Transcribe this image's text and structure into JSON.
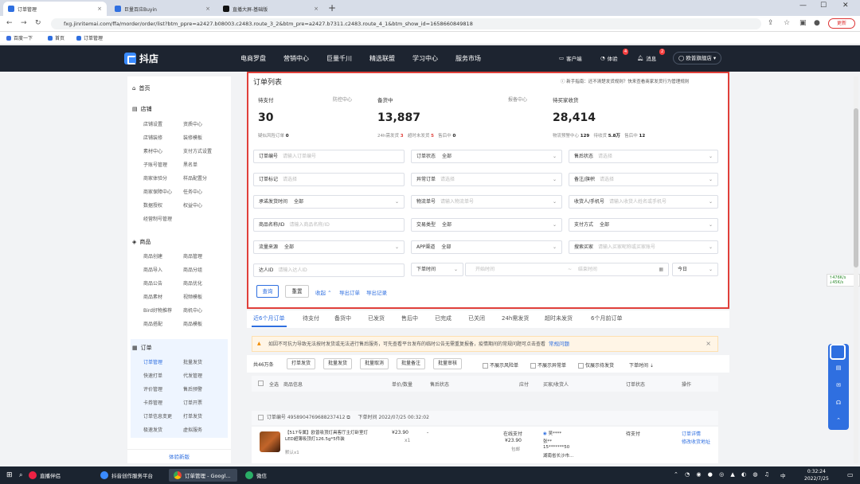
{
  "browser": {
    "tabs": [
      {
        "label": "订单管理",
        "active": true
      },
      {
        "label": "巨量百应Buyin",
        "active": false
      },
      {
        "label": "直播大屏-基础版",
        "active": false
      }
    ],
    "url": "fxg.jinritemai.com/ffa/morder/order/list?btm_ppre=a2427.b08003.c2483.route_3_2&btm_pre=a2427.b7311.c2483.route_4_1&btm_show_id=1658660849818",
    "update_label": "更新",
    "bookmarks": [
      "百度一下",
      "首页",
      "订单管理"
    ]
  },
  "app": {
    "logo_text": "抖店",
    "nav": [
      "电商罗盘",
      "营销中心",
      "巨量千川",
      "精选联盟",
      "学习中心",
      "服务市场"
    ],
    "header_right": {
      "service": "客户端",
      "experience": "体验",
      "experience_badge": "4",
      "messages": "消息",
      "messages_badge": "2",
      "user": "欧普旗舰店"
    }
  },
  "sidebar": {
    "home": "首页",
    "store_section": "店铺",
    "store_items": [
      [
        "店铺设置",
        "资质中心"
      ],
      [
        "店铺装修",
        "装修模板"
      ],
      [
        "素材中心",
        "支付方式设置"
      ],
      [
        "子账号管理",
        "黑名单"
      ],
      [
        "商家体验分",
        "样品配置分"
      ],
      [
        "商家保障中心",
        "任务中心"
      ],
      [
        "数据授权",
        "权益中心"
      ],
      [
        "经营制号管理",
        ""
      ]
    ],
    "goods_section": "商品",
    "goods_items": [
      [
        "商品创建",
        "商品管理"
      ],
      [
        "商品导入",
        "商品分组"
      ],
      [
        "商品公告",
        "商品优化"
      ],
      [
        "商品素材",
        "视频模板"
      ],
      [
        "Bird好物推荐",
        "商机中心"
      ],
      [
        "商品搭配",
        "商品模板"
      ]
    ],
    "order_section": "订单",
    "order_items": [
      [
        "订单管理",
        "批量发货"
      ],
      [
        "快速打单",
        "代发管理"
      ],
      [
        "评价管理",
        "售后预警"
      ],
      [
        "卡券管理",
        "订单开票"
      ],
      [
        "订单信息变更",
        "打单发货"
      ],
      [
        "极速发货",
        "虚拟服务"
      ]
    ],
    "footer": "体验新版"
  },
  "order_panel": {
    "title": "订单列表",
    "tip": "新手指南：还不清楚发货规则？快来查看商家发货行为管理规则",
    "stats": [
      {
        "label": "待支付",
        "extra": "防控中心",
        "value": "30",
        "sub": "疑似风险订单",
        "sub_value": "0"
      },
      {
        "label": "备货中",
        "extra": "报备中心",
        "value": "13,887",
        "sub": "24h需发货",
        "sub_value": "3",
        "sub2": "超时未发货",
        "sub2_value": "5",
        "sub3": "售后中",
        "sub3_value": "0"
      },
      {
        "label": "待买家收货",
        "extra": "",
        "value": "28,414",
        "sub": "物流预警中心",
        "sub_value": "129",
        "sub2": "待收货",
        "sub2_value": "5.8万",
        "sub3": "售后中",
        "sub3_value": "12"
      }
    ],
    "filters": [
      {
        "label": "订单编号",
        "value": "",
        "placeholder": "请输入订单编号"
      },
      {
        "label": "订单状态",
        "value": "全部",
        "placeholder": ""
      },
      {
        "label": "售后状态",
        "value": "",
        "placeholder": "请选择"
      },
      {
        "label": "订单标记",
        "value": "",
        "placeholder": "请选择"
      },
      {
        "label": "异常订单",
        "value": "",
        "placeholder": "请选择"
      },
      {
        "label": "备注/旗帜",
        "value": "",
        "placeholder": "请选择"
      },
      {
        "label": "承诺发货时间",
        "value": "全部",
        "placeholder": ""
      },
      {
        "label": "物流单号",
        "value": "",
        "placeholder": "请输入物流单号"
      },
      {
        "label": "收货人/手机号",
        "value": "",
        "placeholder": "请输入收货人姓名或手机号"
      },
      {
        "label": "商品名称/ID",
        "value": "",
        "placeholder": "请输入商品名称/ID"
      },
      {
        "label": "交易类型",
        "value": "全部",
        "placeholder": ""
      },
      {
        "label": "支付方式",
        "value": "全部",
        "placeholder": ""
      },
      {
        "label": "流量来源",
        "value": "全部",
        "placeholder": ""
      },
      {
        "label": "APP渠道",
        "value": "全部",
        "placeholder": ""
      },
      {
        "label": "搜索买家",
        "value": "",
        "placeholder": "请输入买家昵称或买家账号"
      },
      {
        "label": "达人ID",
        "value": "",
        "placeholder": "请输入达人ID"
      }
    ],
    "time_select": "下单时间",
    "time_start": "开始时间",
    "time_sep": "~",
    "time_end": "结束时间",
    "time_today": "今日",
    "buttons": {
      "query": "查询",
      "reset": "重置",
      "collapse": "收起",
      "export": "导出订单",
      "export_log": "导出记录"
    }
  },
  "order_tabs": [
    "近6个月订单",
    "待支付",
    "备货中",
    "已发货",
    "售后中",
    "已完成",
    "已关闭",
    "24h需发货",
    "超时未发货",
    "6个月前订单"
  ],
  "notice": {
    "text": "如因不可抗力导致无法按时发货或无法进行售后服务，可先查看平台发布的临时公告无需重复报备，疫情期间的常规问题可点击查看",
    "link": "常规问题"
  },
  "toolbar": {
    "count": "共46万条",
    "actions": [
      "打单发货",
      "批量发货",
      "批量取消",
      "批量备注",
      "批量审核"
    ],
    "checks": [
      "不展示风险单",
      "不展示异常单",
      "仅展示待发货"
    ],
    "sort": "下单时间"
  },
  "table": {
    "headers": [
      "全选",
      "商品信息",
      "单价/数量",
      "售后状态",
      "应付",
      "买家/收货人",
      "订单状态",
      "操作"
    ]
  },
  "order": {
    "id_label": "订单编号",
    "id": "4958904769688237412",
    "time_label": "下单时间",
    "time": "2022/07/25 00:32:02",
    "product": "【517专属】欧普吸顶灯具客厅主灯卧室灯LED超薄吸顶灯126.5g*5件装",
    "spec": "默认x1",
    "price": "¥23.90",
    "qty": "x1",
    "after_sale": "-",
    "payable_label": "在线支付",
    "payable": "¥23.90",
    "shipping": "包邮",
    "buyer": "吴****",
    "receiver": "张**",
    "phone": "15*******50",
    "address": "湖南省长沙市...",
    "status": "待支付",
    "op1": "订单详情",
    "op2": "修改收货地址"
  },
  "side_float": {
    "net_up": "476K/s",
    "net_down": "45K/s"
  },
  "taskbar": {
    "items": [
      "直播伴侣",
      "抖音创作服务平台",
      "订单管理 - Googl...",
      "微信"
    ],
    "time": "0:32:24",
    "date": "2022/7/25",
    "lang": "中"
  }
}
